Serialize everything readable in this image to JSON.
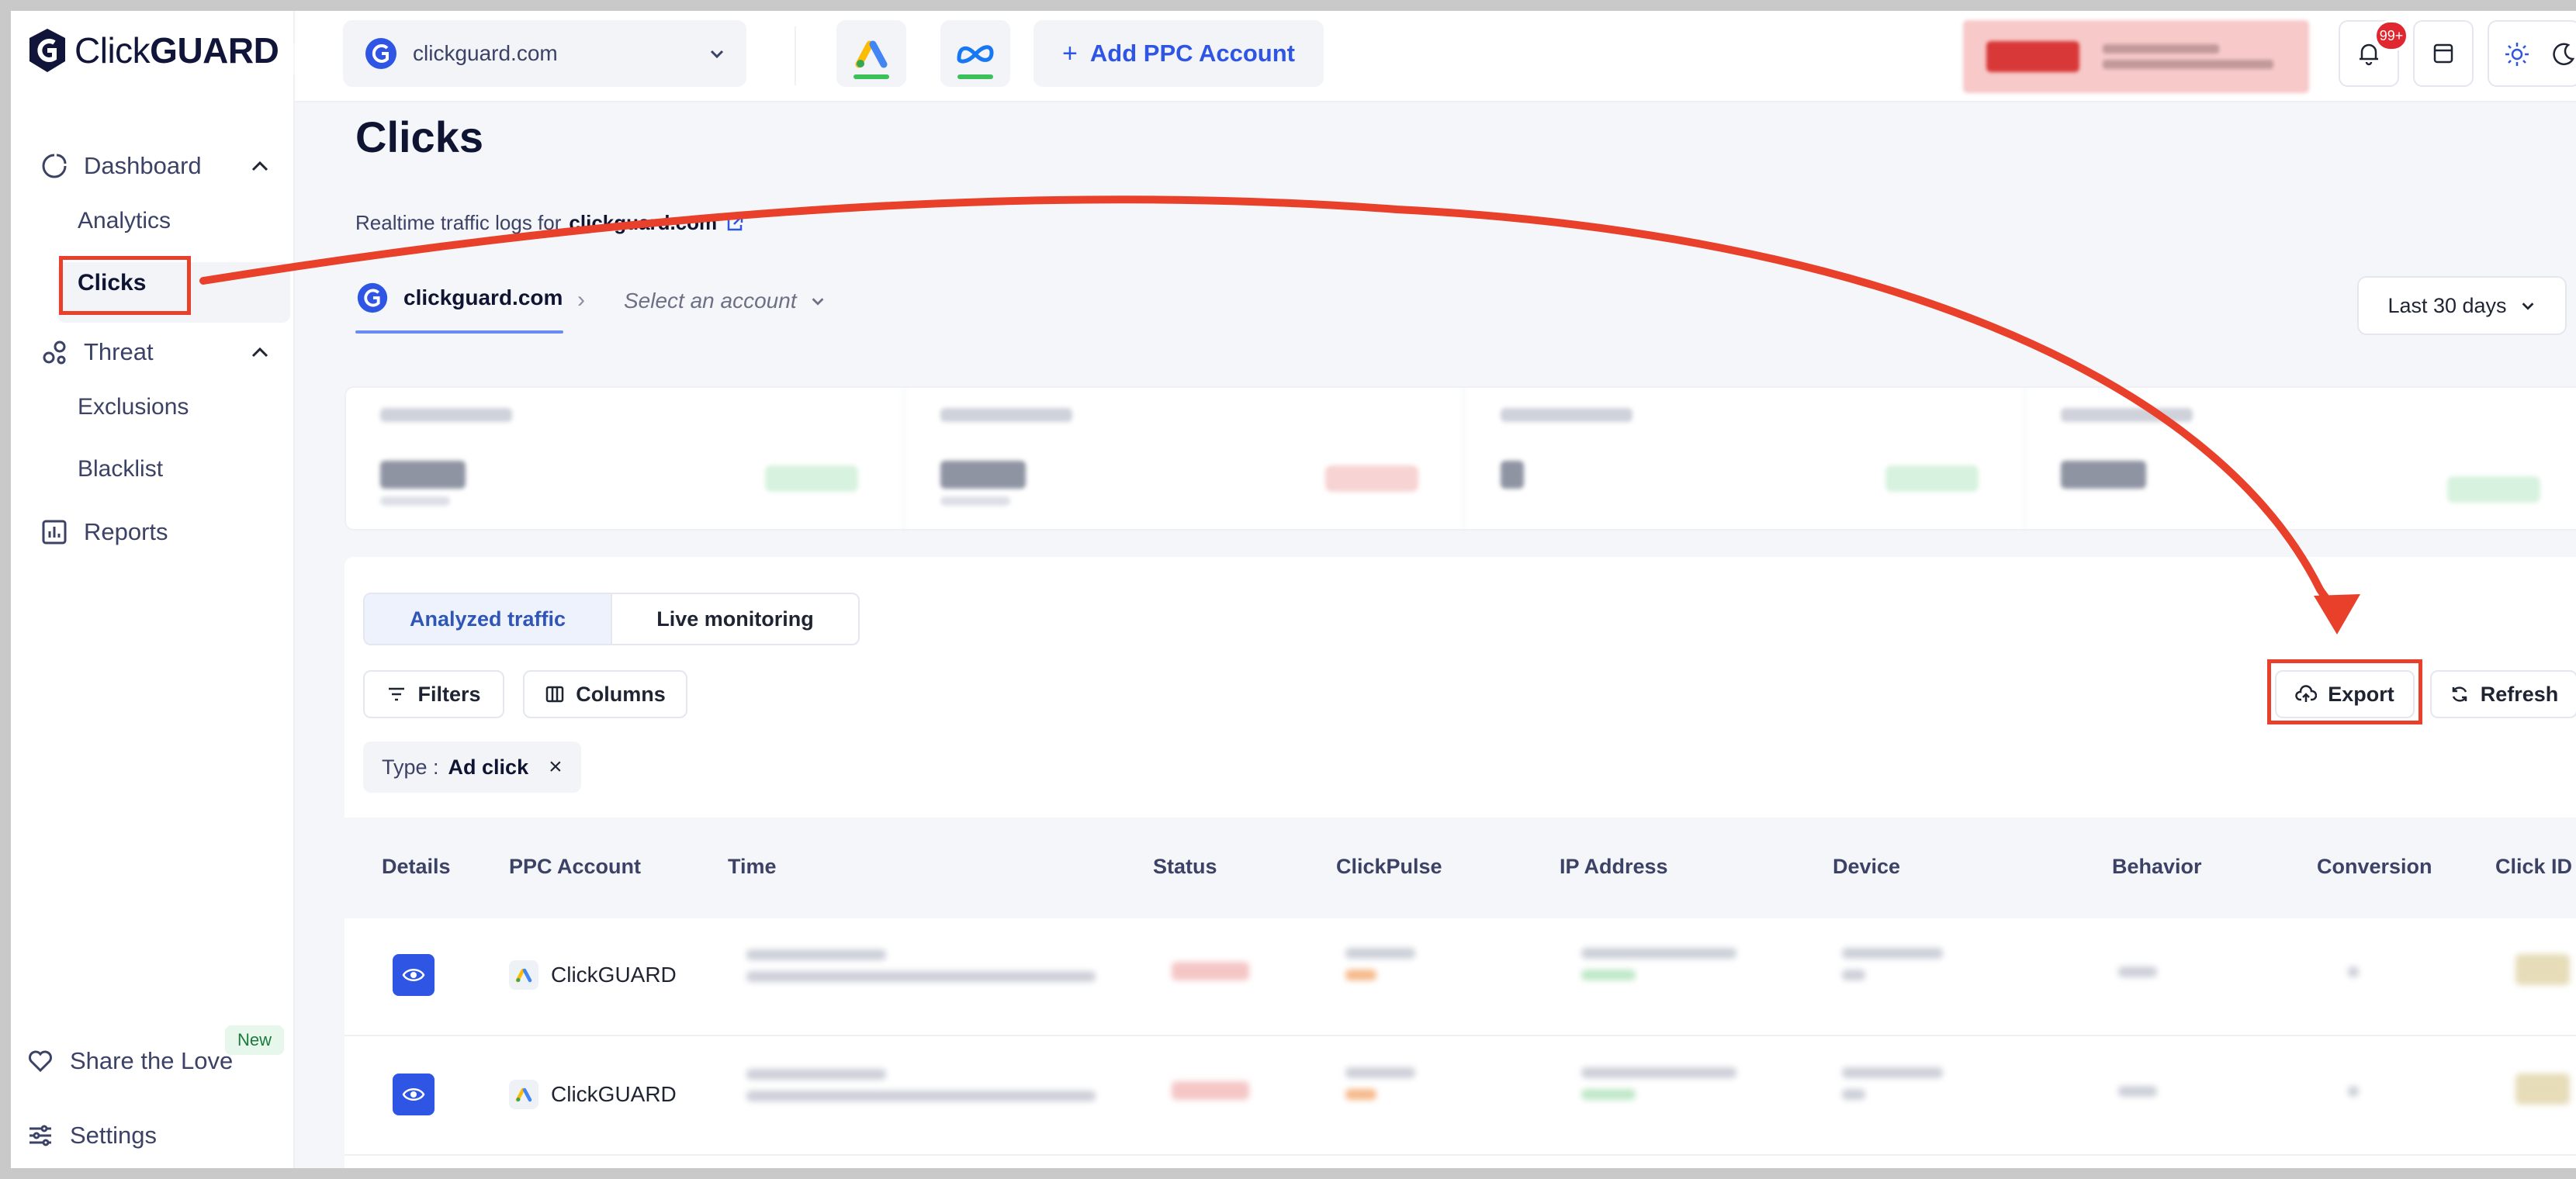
{
  "brand": {
    "logo_prefix": "Click",
    "logo_suffix": "GUARD"
  },
  "sidebar": {
    "dashboard": "Dashboard",
    "analytics": "Analytics",
    "clicks": "Clicks",
    "threat": "Threat",
    "exclusions": "Exclusions",
    "blacklist": "Blacklist",
    "reports": "Reports",
    "share": "Share the Love",
    "share_badge": "New",
    "settings": "Settings"
  },
  "topbar": {
    "site": "clickguard.com",
    "add_ppc": "Add PPC Account",
    "notif_count": "99+"
  },
  "page": {
    "title": "Clicks",
    "subtitle_prefix": "Realtime traffic logs for",
    "subtitle_site": "clickguard.com",
    "crumb_site": "clickguard.com",
    "account_placeholder": "Select an account",
    "date_range": "Last 30 days"
  },
  "tabs": {
    "analyzed": "Analyzed traffic",
    "live": "Live monitoring"
  },
  "toolbar": {
    "filters": "Filters",
    "columns": "Columns",
    "export": "Export",
    "refresh": "Refresh"
  },
  "filter_chip": {
    "label": "Type :",
    "value": "Ad click"
  },
  "table": {
    "headers": [
      "Details",
      "PPC Account",
      "Time",
      "Status",
      "ClickPulse",
      "IP Address",
      "Device",
      "Behavior",
      "Conversion",
      "Click ID"
    ],
    "rows": [
      {
        "account": "ClickGUARD"
      },
      {
        "account": "ClickGUARD"
      }
    ]
  },
  "colors": {
    "accent": "#2f55e4",
    "annotation": "#e8402a",
    "google_green": "#3cc05a"
  }
}
